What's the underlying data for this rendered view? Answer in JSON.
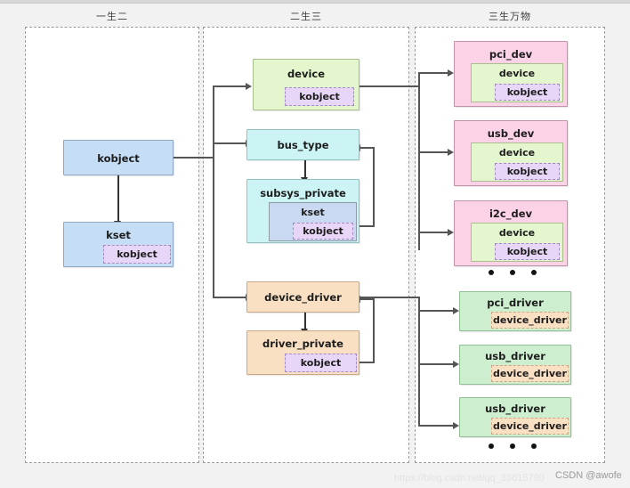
{
  "columns": [
    {
      "title": "一生二"
    },
    {
      "title": "二生三"
    },
    {
      "title": "三生万物"
    }
  ],
  "nodes": {
    "kobject": {
      "title": "kobject"
    },
    "kset": {
      "title": "kset",
      "nested": "kobject"
    },
    "device": {
      "title": "device",
      "nested": "kobject"
    },
    "bus_type": {
      "title": "bus_type"
    },
    "subsys_private": {
      "title": "subsys_private",
      "nested": "kset",
      "nested2": "kobject"
    },
    "device_driver": {
      "title": "device_driver"
    },
    "driver_private": {
      "title": "driver_private",
      "nested": "kobject"
    },
    "pci_dev": {
      "title": "pci_dev",
      "nested": "device",
      "nested2": "kobject"
    },
    "usb_dev": {
      "title": "usb_dev",
      "nested": "device",
      "nested2": "kobject"
    },
    "i2c_dev": {
      "title": "i2c_dev",
      "nested": "device",
      "nested2": "kobject"
    },
    "pci_driver": {
      "title": "pci_driver",
      "nested": "device_driver"
    },
    "usb_driver_1": {
      "title": "usb_driver",
      "nested": "device_driver"
    },
    "usb_driver_2": {
      "title": "usb_driver",
      "nested": "device_driver"
    }
  },
  "colors": {
    "blue": "#c5def5",
    "purple": "#e7d6f7",
    "green": "#e4f6cd",
    "cyan": "#ccf4f4",
    "orange": "#fae0c3",
    "pink": "#fcd2e6",
    "light_green": "#cdefcf",
    "kset_blue": "#c9d9f2",
    "page_background": "#f2f2f2",
    "panel_background": "#ffffff",
    "connector": "#555555"
  },
  "watermarks": {
    "url": "https://blog.csdn.net/qq_33615790",
    "tag": "CSDN @awofe"
  }
}
